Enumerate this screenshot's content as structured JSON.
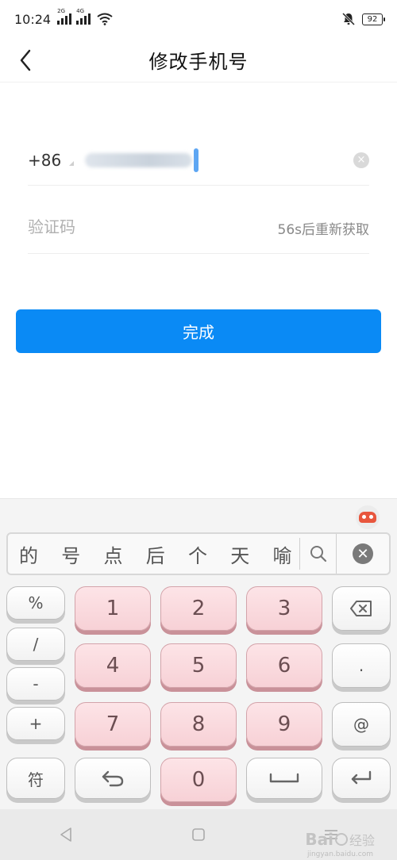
{
  "status_bar": {
    "time": "10:24",
    "signal1_tag": "2G",
    "signal2_tag": "4G",
    "battery": "92"
  },
  "header": {
    "title": "修改手机号"
  },
  "form": {
    "country_code": "+86",
    "code_placeholder": "验证码",
    "resend_label": "56s后重新获取",
    "clear_symbol": "×"
  },
  "done_button": {
    "label": "完成",
    "color": "#0a8af5"
  },
  "keyboard": {
    "candidates": [
      "的",
      "号",
      "点",
      "后",
      "个",
      "天",
      "喻"
    ],
    "search_icon": "search-icon",
    "close_symbol": "✕",
    "side_keys": [
      "%",
      "/",
      "-",
      "+",
      "符"
    ],
    "digits": [
      "1",
      "2",
      "3",
      "4",
      "5",
      "6",
      "7",
      "8",
      "9",
      "0"
    ],
    "right_keys": {
      "dot": ".",
      "at": "@"
    }
  },
  "watermark": {
    "brand": "Bai",
    "text": "经验",
    "sub": "jingyan.baidu.com"
  }
}
